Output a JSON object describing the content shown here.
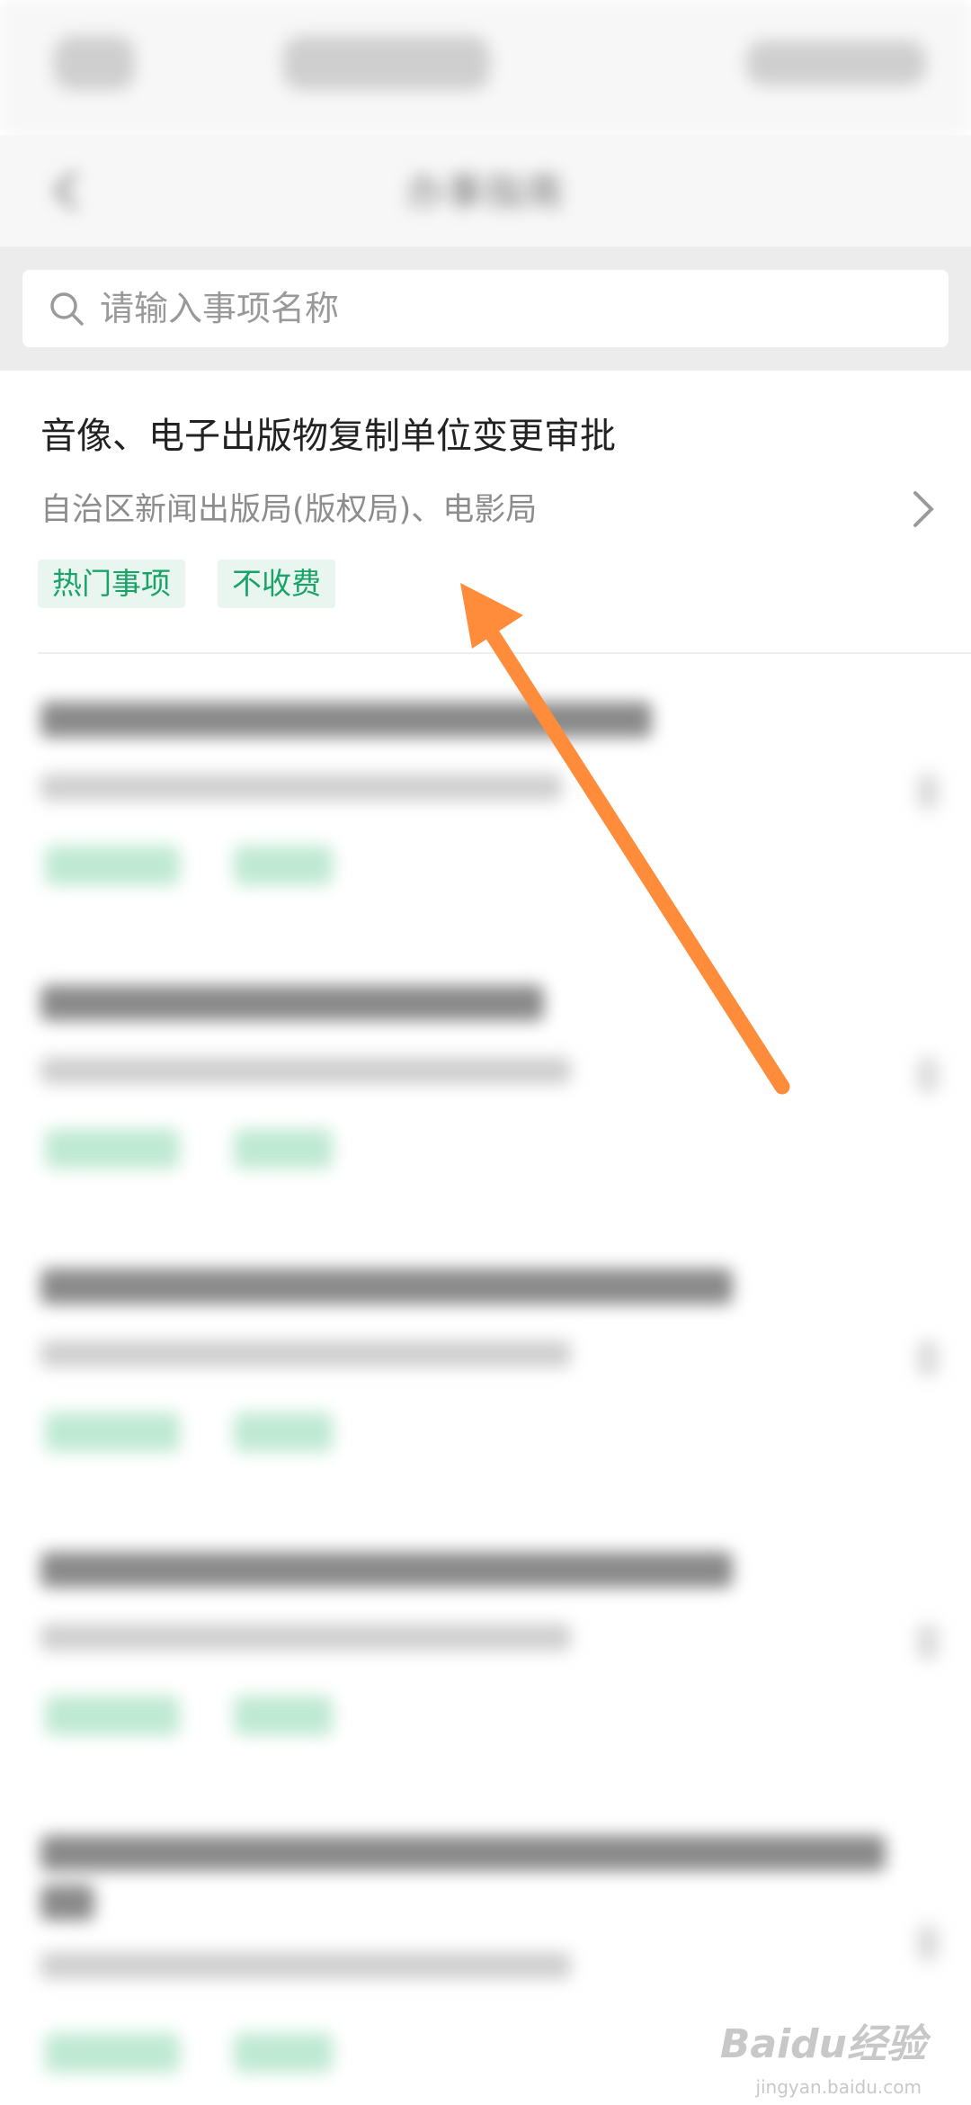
{
  "header": {
    "title": "办事指南"
  },
  "search": {
    "placeholder": "请输入事项名称"
  },
  "items": [
    {
      "title": "音像、电子出版物复制单位变更审批",
      "department": "自治区新闻出版局(版权局)、电影局",
      "tags": [
        "热门事项",
        "不收费"
      ]
    }
  ],
  "watermark": {
    "brand": "Baidu经验",
    "url": "jingyan.baidu.com"
  },
  "colors": {
    "accent": "#1aa368",
    "tag_bg": "#e8f6ef",
    "annotation_arrow": "#ff8c3a"
  }
}
